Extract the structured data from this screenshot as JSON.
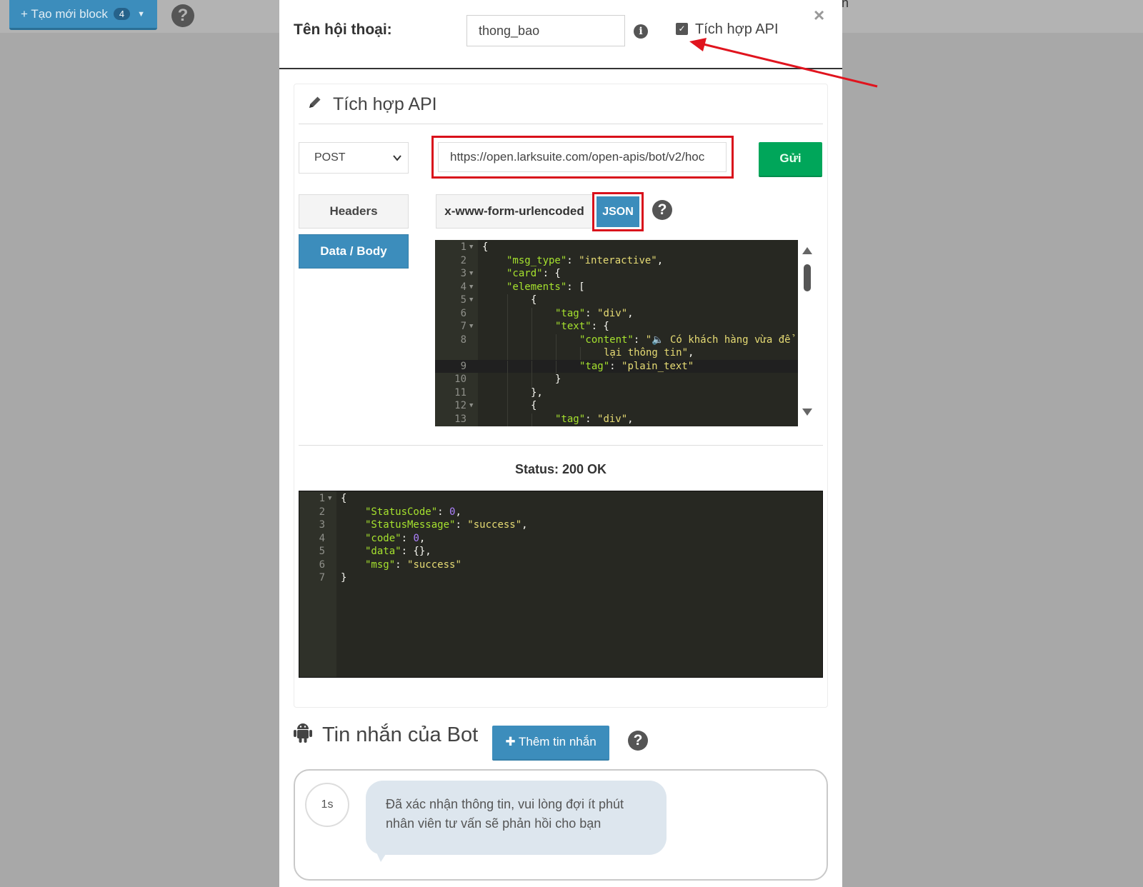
{
  "topbar": {
    "create_block_label": "+ Tạo mới block",
    "create_block_count": "4",
    "help_label": "?",
    "corner_fragment": "n"
  },
  "dialog": {
    "name_label": "Tên hội thoại:",
    "name_value": "thong_bao",
    "api_checkbox_label": "Tích hợp API",
    "api_checkbox_checked": true,
    "close_label": "×"
  },
  "api_panel": {
    "title": "Tích hợp API",
    "method": "POST",
    "url": "https://open.larksuite.com/open-apis/bot/v2/hoc",
    "send_label": "Gửi",
    "tabs": {
      "headers": "Headers",
      "data_body": "Data / Body"
    },
    "body_formats": {
      "urlencoded": "x-www-form-urlencoded",
      "json": "JSON"
    },
    "help_label": "?",
    "status_text": "Status: 200 OK"
  },
  "request_body": {
    "lines": [
      {
        "n": "1",
        "fold": true,
        "indent": 0,
        "tokens": [
          [
            "p",
            "{"
          ]
        ]
      },
      {
        "n": "2",
        "fold": false,
        "indent": 1,
        "tokens": [
          [
            "k",
            "\"msg_type\""
          ],
          [
            "p",
            ": "
          ],
          [
            "s",
            "\"interactive\""
          ],
          [
            "p",
            ","
          ]
        ]
      },
      {
        "n": "3",
        "fold": true,
        "indent": 1,
        "tokens": [
          [
            "k",
            "\"card\""
          ],
          [
            "p",
            ": {"
          ]
        ]
      },
      {
        "n": "4",
        "fold": true,
        "indent": 1,
        "tokens": [
          [
            "k",
            "\"elements\""
          ],
          [
            "p",
            ": ["
          ]
        ]
      },
      {
        "n": "5",
        "fold": true,
        "indent": 2,
        "tokens": [
          [
            "p",
            "{"
          ]
        ]
      },
      {
        "n": "6",
        "fold": false,
        "indent": 3,
        "tokens": [
          [
            "k",
            "\"tag\""
          ],
          [
            "p",
            ": "
          ],
          [
            "s",
            "\"div\""
          ],
          [
            "p",
            ","
          ]
        ]
      },
      {
        "n": "7",
        "fold": true,
        "indent": 3,
        "tokens": [
          [
            "k",
            "\"text\""
          ],
          [
            "p",
            ": {"
          ]
        ]
      },
      {
        "n": "8",
        "fold": false,
        "indent": 4,
        "tokens": [
          [
            "k",
            "\"content\""
          ],
          [
            "p",
            ": "
          ],
          [
            "s",
            "\"🔈 Có khách hàng vừa để"
          ]
        ]
      },
      {
        "n": "",
        "fold": false,
        "indent": 5,
        "tokens": [
          [
            "s",
            "lại thông tin\""
          ],
          [
            "p",
            ","
          ]
        ]
      },
      {
        "n": "9",
        "fold": false,
        "indent": 4,
        "tokens": [
          [
            "k",
            "\"tag\""
          ],
          [
            "p",
            ": "
          ],
          [
            "s",
            "\"plain_text\""
          ]
        ],
        "active": true
      },
      {
        "n": "10",
        "fold": false,
        "indent": 3,
        "tokens": [
          [
            "p",
            "}"
          ]
        ]
      },
      {
        "n": "11",
        "fold": false,
        "indent": 2,
        "tokens": [
          [
            "p",
            "},"
          ]
        ]
      },
      {
        "n": "12",
        "fold": true,
        "indent": 2,
        "tokens": [
          [
            "p",
            "{"
          ]
        ]
      },
      {
        "n": "13",
        "fold": false,
        "indent": 3,
        "tokens": [
          [
            "k",
            "\"tag\""
          ],
          [
            "p",
            ": "
          ],
          [
            "s",
            "\"div\""
          ],
          [
            "p",
            ","
          ]
        ]
      }
    ]
  },
  "response_body": {
    "lines": [
      {
        "n": "1",
        "fold": true,
        "indent": 0,
        "tokens": [
          [
            "p",
            "{"
          ]
        ]
      },
      {
        "n": "2",
        "fold": false,
        "indent": 1,
        "tokens": [
          [
            "k",
            "\"StatusCode\""
          ],
          [
            "p",
            ": "
          ],
          [
            "n",
            "0"
          ],
          [
            "p",
            ","
          ]
        ]
      },
      {
        "n": "3",
        "fold": false,
        "indent": 1,
        "tokens": [
          [
            "k",
            "\"StatusMessage\""
          ],
          [
            "p",
            ": "
          ],
          [
            "s",
            "\"success\""
          ],
          [
            "p",
            ","
          ]
        ]
      },
      {
        "n": "4",
        "fold": false,
        "indent": 1,
        "tokens": [
          [
            "k",
            "\"code\""
          ],
          [
            "p",
            ": "
          ],
          [
            "n",
            "0"
          ],
          [
            "p",
            ","
          ]
        ]
      },
      {
        "n": "5",
        "fold": false,
        "indent": 1,
        "tokens": [
          [
            "k",
            "\"data\""
          ],
          [
            "p",
            ": {},"
          ]
        ]
      },
      {
        "n": "6",
        "fold": false,
        "indent": 1,
        "tokens": [
          [
            "k",
            "\"msg\""
          ],
          [
            "p",
            ": "
          ],
          [
            "s",
            "\"success\""
          ]
        ]
      },
      {
        "n": "7",
        "fold": false,
        "indent": 0,
        "tokens": [
          [
            "p",
            "}"
          ]
        ]
      }
    ]
  },
  "bot_messages": {
    "title": "Tin nhắn của Bot",
    "add_label": "Thêm tin nhắn",
    "help_label": "?",
    "items": [
      {
        "delay": "1s",
        "text": "Đã xác nhận thông tin, vui lòng đợi ít phút nhân viên tư vấn sẽ phản hồi cho bạn"
      }
    ]
  },
  "colors": {
    "accent_blue": "#3c8dbc",
    "send_green": "#00a65a",
    "highlight_red": "#d9101b",
    "editor_bg": "#272822"
  },
  "icons": {
    "pencil": "pencil-icon",
    "info": "info-icon",
    "help": "question-circle-icon",
    "close": "close-icon",
    "android": "android-icon",
    "plus": "plus-icon",
    "chevron": "chevron-down-icon"
  }
}
